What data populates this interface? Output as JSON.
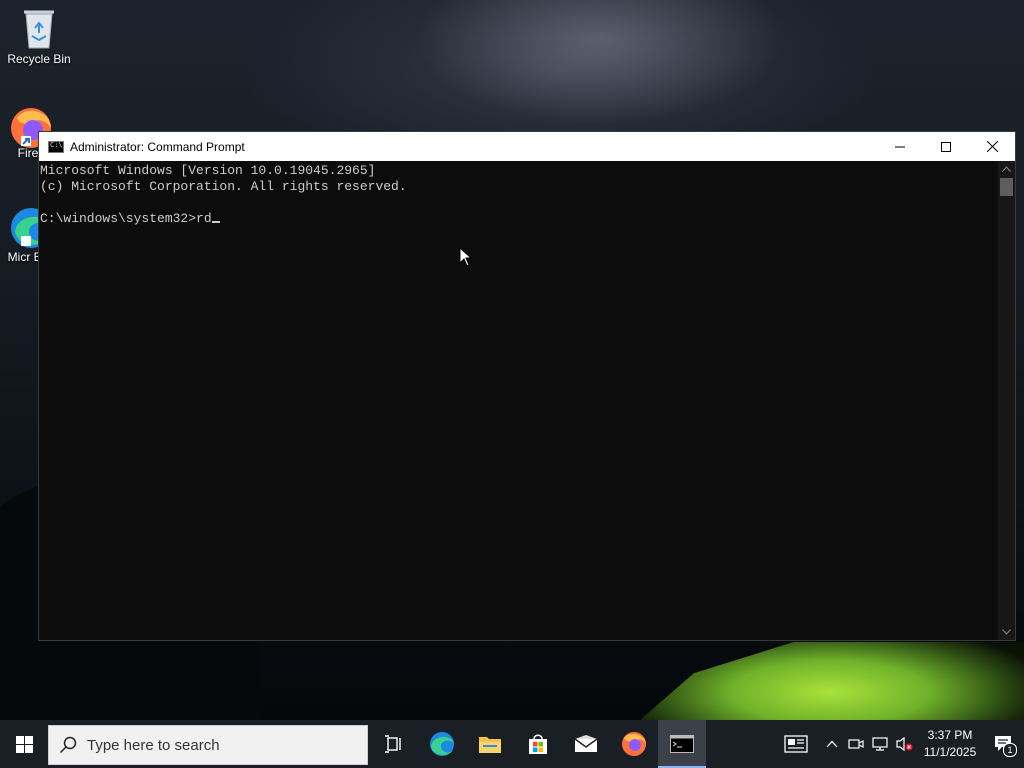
{
  "desktop": {
    "icons": [
      {
        "label": "Recycle Bin"
      },
      {
        "label": "Fire"
      },
      {
        "label": "Micr Ed"
      }
    ]
  },
  "window": {
    "title": "Administrator: Command Prompt",
    "console_lines": [
      "Microsoft Windows [Version 10.0.19045.2965]",
      "(c) Microsoft Corporation. All rights reserved.",
      "",
      "C:\\windows\\system32>rd"
    ]
  },
  "taskbar": {
    "search_placeholder": "Type here to search",
    "pinned": [
      "task-view",
      "edge",
      "file-explorer",
      "store",
      "mail",
      "firefox",
      "command-prompt"
    ],
    "active_app": "command-prompt",
    "clock": {
      "time": "3:37 PM",
      "date": "11/1/2025"
    },
    "notification_count": "1"
  },
  "colors": {
    "console_bg": "#0c0c0c",
    "console_text": "#cccccc",
    "taskbar_bg": "#1a1f26"
  }
}
